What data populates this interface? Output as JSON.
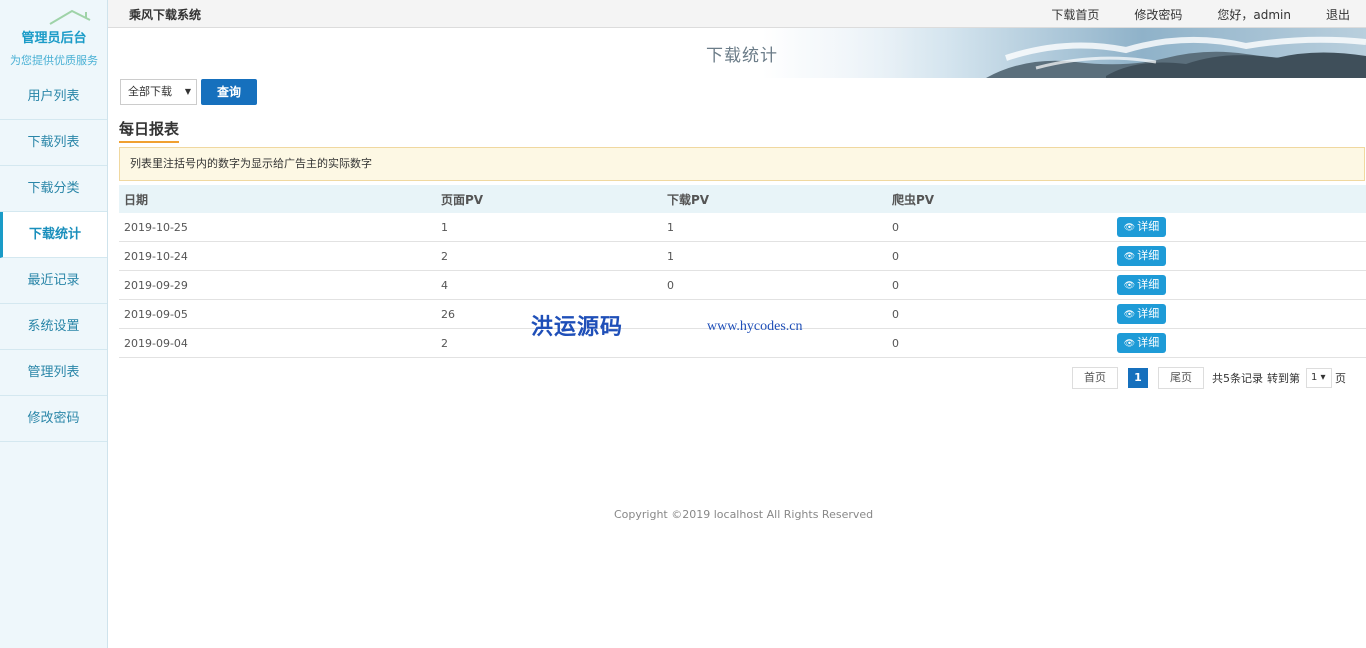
{
  "brand": {
    "title": "管理员后台",
    "subtitle": "为您提供优质服务"
  },
  "sidebar": {
    "items": [
      {
        "label": "用户列表"
      },
      {
        "label": "下载列表"
      },
      {
        "label": "下载分类"
      },
      {
        "label": "下载统计",
        "active": true
      },
      {
        "label": "最近记录"
      },
      {
        "label": "系统设置"
      },
      {
        "label": "管理列表"
      },
      {
        "label": "修改密码"
      }
    ]
  },
  "topbar": {
    "system_name": "乘风下载系统",
    "links": [
      "下载首页",
      "修改密码",
      "您好，admin",
      "退出"
    ]
  },
  "header": {
    "title": "下载统计"
  },
  "filter": {
    "selected": "全部下载",
    "query_label": "查询"
  },
  "report": {
    "title": "每日报表",
    "notice": "列表里注括号内的数字为显示给广告主的实际数字",
    "columns": [
      "日期",
      "页面PV",
      "下载PV",
      "爬虫PV",
      ""
    ],
    "detail_label": "详细",
    "rows": [
      {
        "date": "2019-10-25",
        "page_pv": "1",
        "download_pv": "1",
        "crawler_pv": "0"
      },
      {
        "date": "2019-10-24",
        "page_pv": "2",
        "download_pv": "1",
        "crawler_pv": "0"
      },
      {
        "date": "2019-09-29",
        "page_pv": "4",
        "download_pv": "0",
        "crawler_pv": "0"
      },
      {
        "date": "2019-09-05",
        "page_pv": "26",
        "download_pv": "",
        "crawler_pv": "0"
      },
      {
        "date": "2019-09-04",
        "page_pv": "2",
        "download_pv": "",
        "crawler_pv": "0"
      }
    ]
  },
  "pagination": {
    "first": "首页",
    "current": "1",
    "last": "尾页",
    "total": "共5条记录",
    "goto": "转到第",
    "page_select": "1",
    "page_unit": "页"
  },
  "watermark": {
    "cn": "洪运源码",
    "url": "www.hycodes.cn"
  },
  "footer": {
    "copyright": "Copyright ©2019 localhost All Rights Reserved"
  }
}
